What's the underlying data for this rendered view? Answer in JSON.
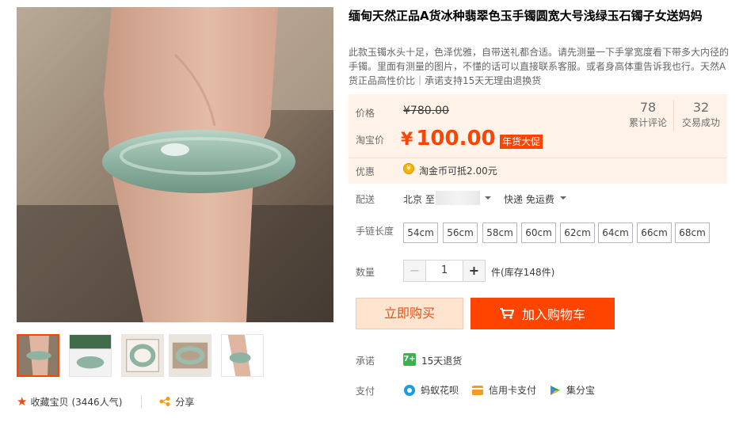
{
  "title": "缅甸天然正品A货冰种翡翠色玉手镯圆宽大号浅绿玉石镯子女送妈妈",
  "subtitle": "此款玉镯水头十足，色泽优雅，自带送礼都合适。请先测量一下手掌宽度看下带多大内径的手镯。里面有测量的图片，不懂的话可以直接联系客服。或者身高体重告诉我也行。天然A货正品高性价比｜承诺支持15天无理由退换货",
  "price": {
    "label": "价格",
    "original": "¥780.00",
    "tb_label": "淘宝价",
    "currency": "¥",
    "current": "100.00",
    "tag": "年货大促"
  },
  "stats": [
    {
      "count": "78",
      "label": "累计评论"
    },
    {
      "count": "32",
      "label": "交易成功"
    }
  ],
  "promo": {
    "label": "优惠",
    "icon": "coin-icon",
    "text": "淘金币可抵2.00元"
  },
  "shipping": {
    "label": "配送",
    "from": "北京 至",
    "method": "快递 免运费"
  },
  "spec": {
    "label": "手链长度",
    "options": [
      "54cm",
      "56cm",
      "58cm",
      "60cm",
      "62cm",
      "64cm",
      "66cm",
      "68cm"
    ]
  },
  "quantity": {
    "label": "数量",
    "value": "1",
    "minus": "−",
    "plus": "+",
    "stock": "件(库存148件)"
  },
  "actions": {
    "buy_now": "立即购买",
    "add_cart": "加入购物车"
  },
  "promise": {
    "label": "承诺",
    "icon_text": "7+",
    "text": "15天退货"
  },
  "payment": {
    "label": "支付",
    "methods": [
      "蚂蚁花呗",
      "信用卡支付",
      "集分宝"
    ]
  },
  "favorite": {
    "label": "收藏宝贝",
    "count": "(3446人气)"
  },
  "share": {
    "label": "分享"
  },
  "colors": {
    "accent": "#ff4400",
    "price_bg": "#fff2e8",
    "jade": "#8fb8a8"
  }
}
